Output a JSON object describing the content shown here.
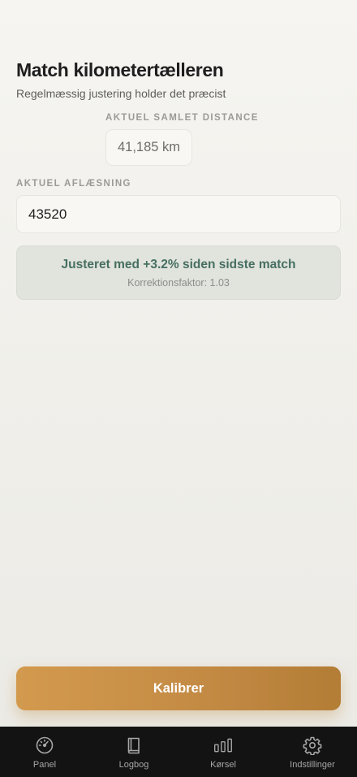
{
  "header": {
    "title": "Match kilometertælleren",
    "subtitle": "Regelmæssig justering holder det præcist"
  },
  "total": {
    "label": "AKTUEL SAMLET DISTANCE",
    "value": "41,185 km"
  },
  "reading": {
    "label": "AKTUEL AFLÆSNING",
    "value": "43520"
  },
  "adjustment": {
    "text": "Justeret med +3.2% siden sidste match",
    "factor": "Korrektionsfaktor: 1.03"
  },
  "actions": {
    "calibrate_label": "Kalibrer"
  },
  "tabbar": {
    "items": [
      {
        "label": "Panel",
        "icon": "speedometer-icon"
      },
      {
        "label": "Logbog",
        "icon": "book-icon"
      },
      {
        "label": "Kørsel",
        "icon": "bar-chart-icon"
      },
      {
        "label": "Indstillinger",
        "icon": "gear-icon"
      }
    ]
  },
  "colors": {
    "accent": "#c48b45",
    "adjust_text": "#466f62",
    "tabbar_bg": "#131313"
  }
}
